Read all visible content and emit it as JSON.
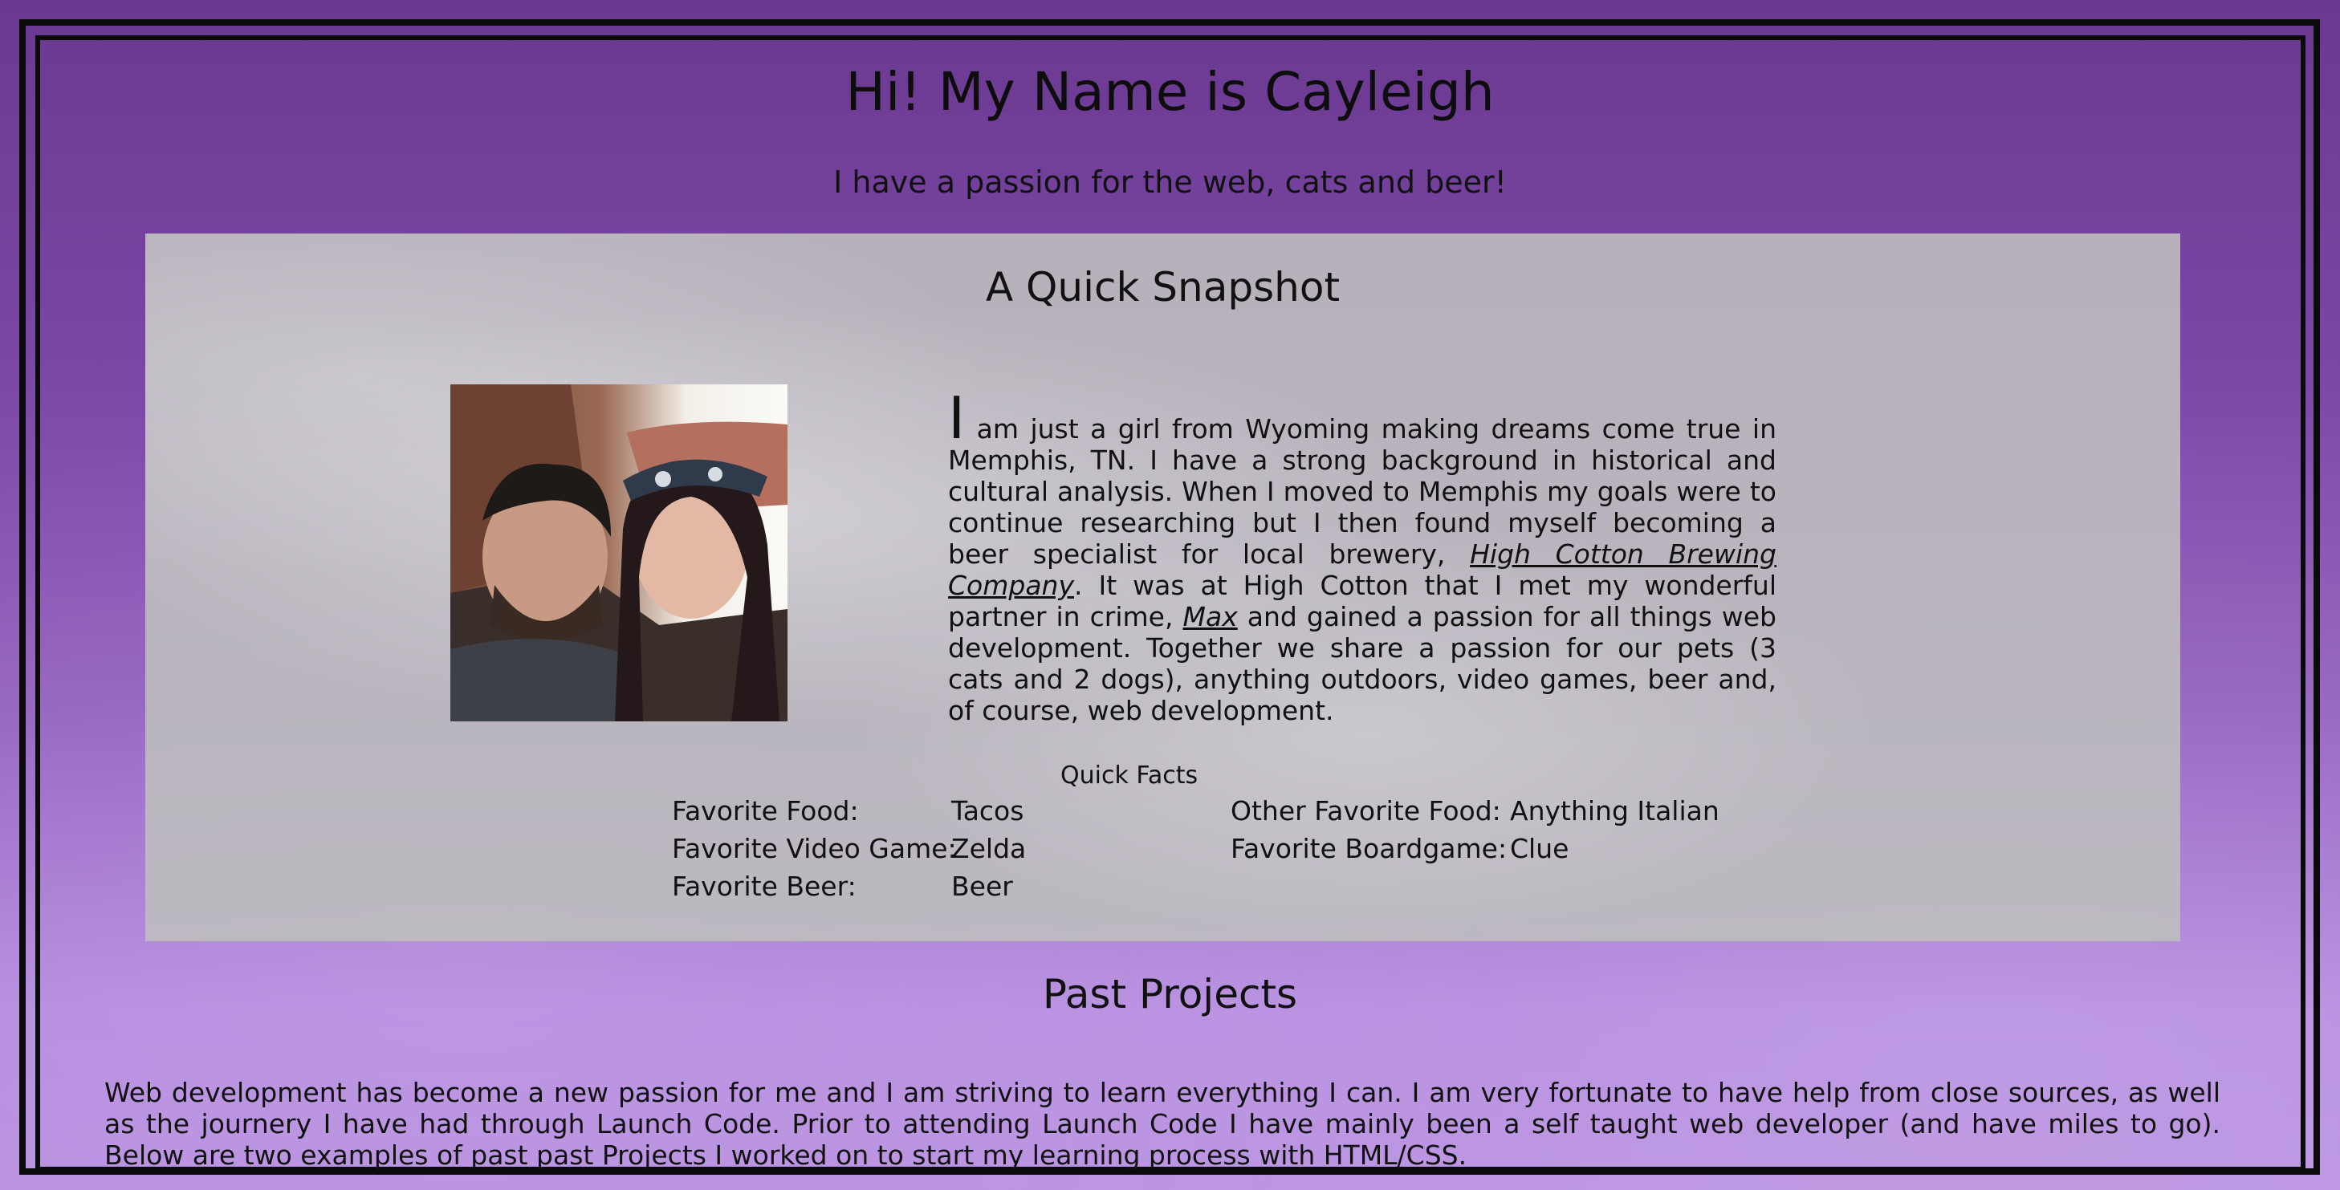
{
  "header": {
    "title": "Hi! My Name is Cayleigh",
    "subtitle": "I have a passion for the web, cats and beer!"
  },
  "snapshot": {
    "title": "A Quick Snapshot",
    "bio": {
      "dropcap": "I",
      "part1": " am just a girl from Wyoming making dreams come true in Memphis, TN. I have a strong background in historical and cultural analysis. When I moved to Memphis my goals were to continue researching but I then found myself becoming a beer specialist for local brewery, ",
      "link1": "High Cotton Brewing Company",
      "part2": ". It was at High Cotton that I met my wonderful partner in crime, ",
      "link2": "Max",
      "part3": " and gained a passion for all things web development. Together we share a passion for our pets (3 cats and 2 dogs), anything outdoors, video games, beer and, of course, web development."
    },
    "quick_facts": {
      "title": "Quick Facts",
      "left": [
        {
          "label": "Favorite Food:",
          "value": "Tacos"
        },
        {
          "label": "Favorite Video Game:",
          "value": "Zelda"
        },
        {
          "label": "Favorite Beer:",
          "value": "Beer"
        }
      ],
      "right": [
        {
          "label": "Other Favorite Food:",
          "value": "Anything Italian"
        },
        {
          "label": "Favorite Boardgame:",
          "value": "Clue"
        }
      ]
    }
  },
  "projects": {
    "title": "Past Projects",
    "text": "Web development has become a new passion for me and I am striving to learn everything I can. I am very fortunate to have help from close sources, as well as the journery I have had through Launch Code. Prior to attending Launch Code I have mainly been a self taught web developer (and have miles to go). Below are two examples of past past Projects I worked on to start my learning process with HTML/CSS."
  }
}
